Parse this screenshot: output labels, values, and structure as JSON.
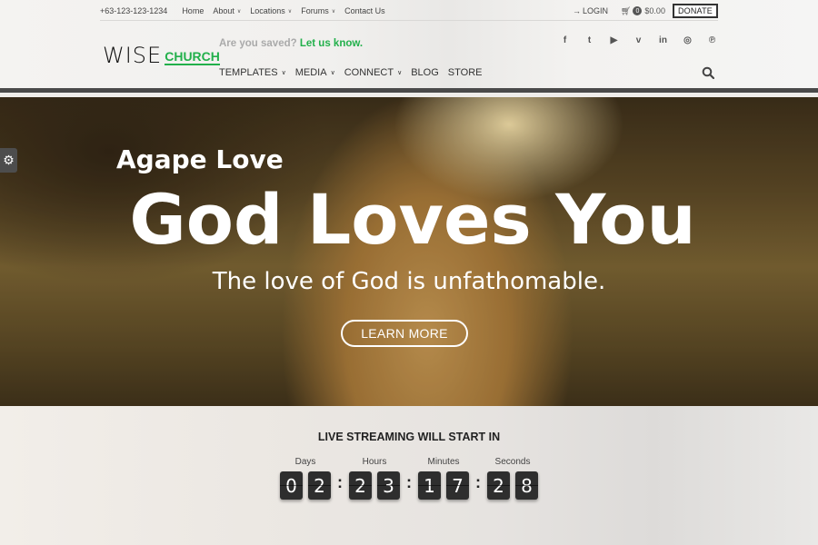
{
  "topbar": {
    "phone": "+63-123-123-1234",
    "links": [
      {
        "label": "Home",
        "dropdown": false
      },
      {
        "label": "About",
        "dropdown": true
      },
      {
        "label": "Locations",
        "dropdown": true
      },
      {
        "label": "Forums",
        "dropdown": true
      },
      {
        "label": "Contact Us",
        "dropdown": false
      }
    ],
    "login_label": "LOGIN",
    "cart_count": "0",
    "cart_total": "$0.00",
    "donate_label": "DONATE"
  },
  "logo": {
    "part1": "WISE",
    "part2": "CHURCH"
  },
  "tagline": {
    "question": "Are you saved?",
    "cta": "Let us know."
  },
  "mainnav": [
    {
      "label": "TEMPLATES",
      "dropdown": true
    },
    {
      "label": "MEDIA",
      "dropdown": true
    },
    {
      "label": "CONNECT",
      "dropdown": true
    },
    {
      "label": "BLOG",
      "dropdown": false
    },
    {
      "label": "STORE",
      "dropdown": false
    }
  ],
  "social": [
    {
      "name": "facebook",
      "glyph": "f"
    },
    {
      "name": "twitter",
      "glyph": "t"
    },
    {
      "name": "youtube",
      "glyph": "▶"
    },
    {
      "name": "vimeo",
      "glyph": "v"
    },
    {
      "name": "linkedin",
      "glyph": "in"
    },
    {
      "name": "instagram",
      "glyph": "◎"
    },
    {
      "name": "pinterest",
      "glyph": "℗"
    }
  ],
  "hero": {
    "kicker": "Agape Love",
    "title": "God Loves You",
    "subtitle": "The love of God is unfathomable.",
    "button": "LEARN MORE"
  },
  "countdown": {
    "title": "LIVE STREAMING WILL START IN",
    "units": [
      {
        "label": "Days",
        "digits": [
          "0",
          "2"
        ]
      },
      {
        "label": "Hours",
        "digits": [
          "2",
          "3"
        ]
      },
      {
        "label": "Minutes",
        "digits": [
          "1",
          "7"
        ]
      },
      {
        "label": "Seconds",
        "digits": [
          "2",
          "8"
        ]
      }
    ]
  },
  "colors": {
    "accent": "#22b04b",
    "dark": "#2e2e2e"
  }
}
